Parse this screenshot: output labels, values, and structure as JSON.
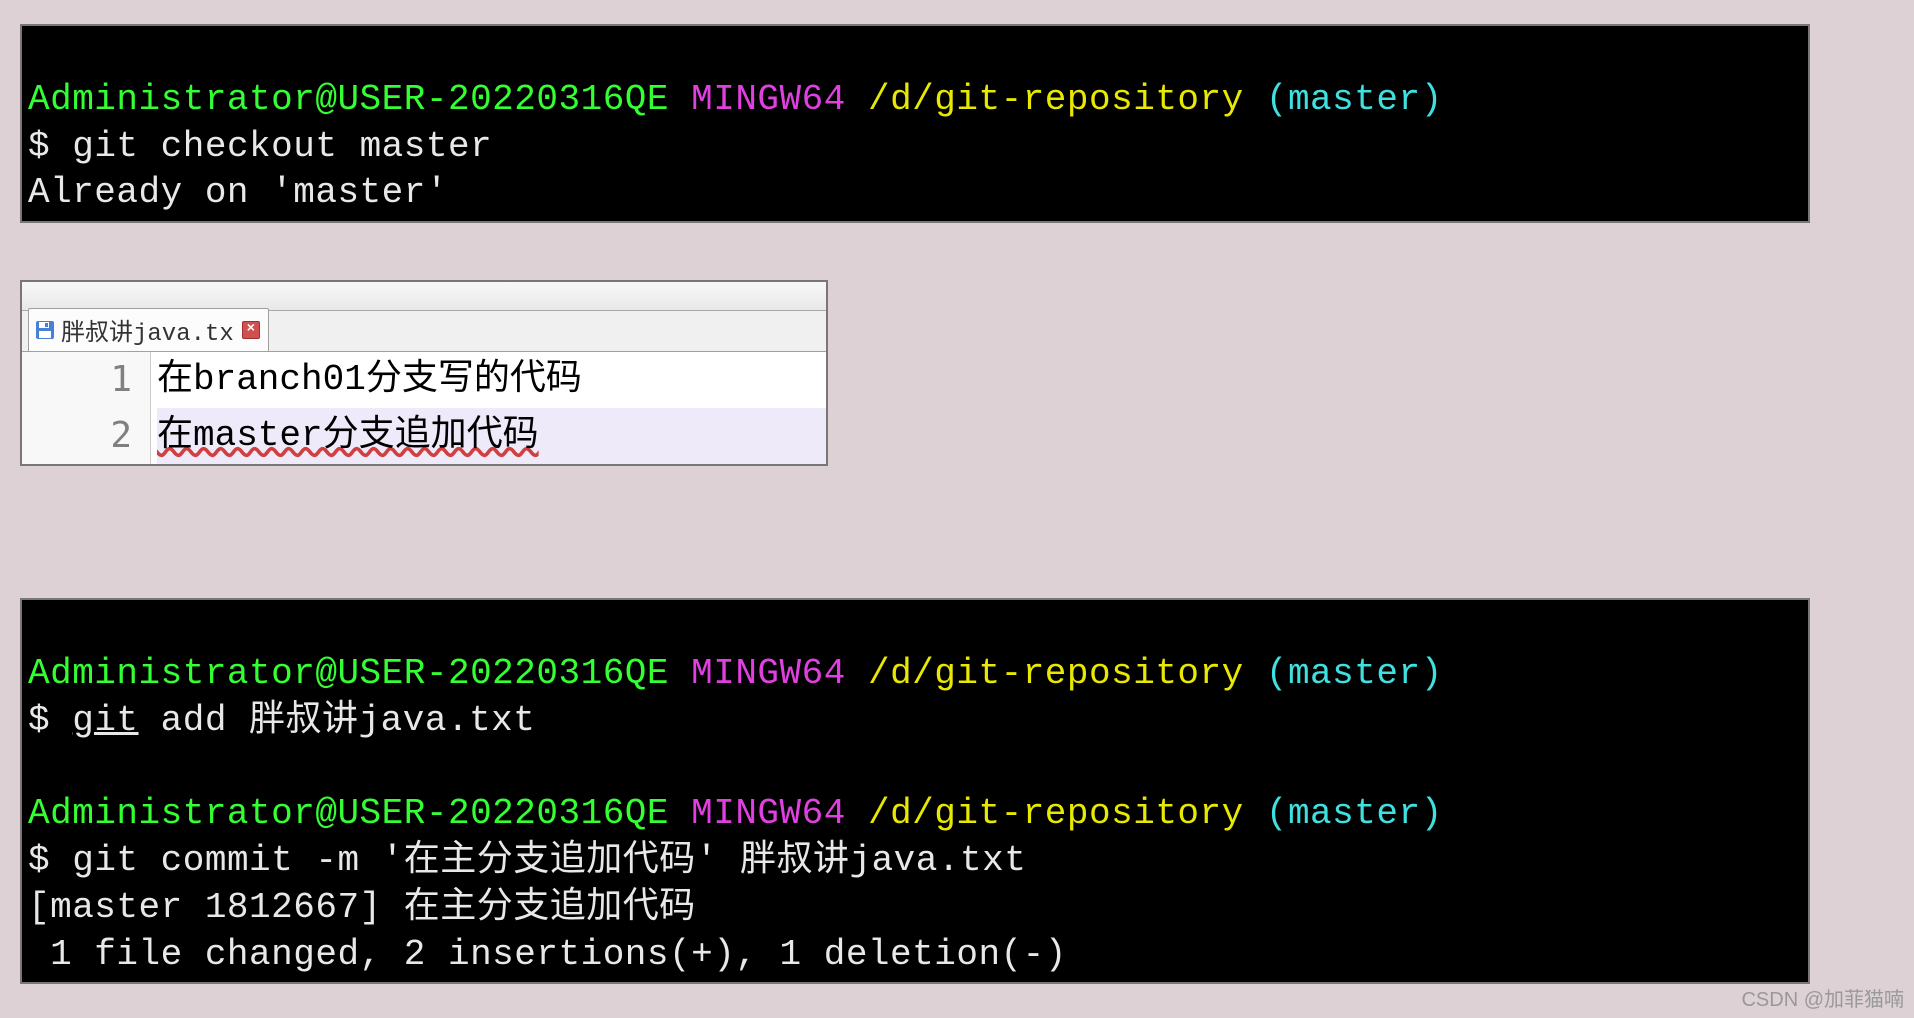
{
  "prompt1": {
    "user": "Administrator@USER-20220316QE",
    "env": "MINGW64",
    "path": "/d/git-repository",
    "branch": "(master)",
    "sym": "$ ",
    "cmd": "git checkout master",
    "out": "Already on 'master'"
  },
  "editor": {
    "tab_name": "胖叔讲java.tx",
    "lines": {
      "n1": "1",
      "n2": "2",
      "l1": "在branch01分支写的代码",
      "l2": "在master分支追加代码"
    }
  },
  "prompt2": {
    "user": "Administrator@USER-20220316QE",
    "env": "MINGW64",
    "path": "/d/git-repository",
    "branch": "(master)",
    "sym": "$ ",
    "cmd_a": "git",
    "cmd_b": " add 胖叔讲java.txt"
  },
  "prompt3": {
    "user": "Administrator@USER-20220316QE",
    "env": "MINGW64",
    "path": "/d/git-repository",
    "branch": "(master)",
    "sym": "$ ",
    "cmd": "git commit -m '在主分支追加代码' 胖叔讲java.txt",
    "out1": "[master 1812667] 在主分支追加代码",
    "out2": " 1 file changed, 2 insertions(+), 1 deletion(-)"
  },
  "watermark": "CSDN @加菲猫喃"
}
